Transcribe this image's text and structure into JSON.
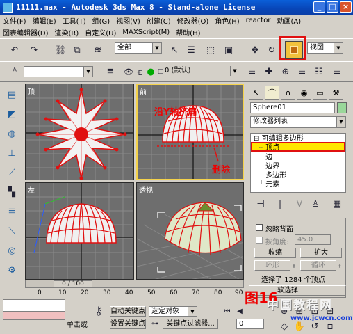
{
  "title": "11111.max - Autodesk 3ds Max 8 - Stand-alone License",
  "menu1": [
    "文件(F)",
    "编辑(E)",
    "工具(T)",
    "组(G)",
    "视图(V)",
    "创建(C)",
    "修改器(O)",
    "角色(H)",
    "reactor",
    "动画(A)"
  ],
  "menu2": [
    "图表编辑器(D)",
    "渲染(R)",
    "自定义(U)",
    "MAXScript(M)",
    "帮助(H)"
  ],
  "toolbar": {
    "selection_filter": "全部",
    "ref_coord": "视图"
  },
  "layer": {
    "current": "0 (默认)"
  },
  "viewports": {
    "top": "顶",
    "front": "前",
    "left": "左",
    "persp": "透视"
  },
  "command_panel": {
    "object_name": "Sphere01",
    "modifier_list": "修改器列表",
    "stack": [
      "可编辑多边形",
      "顶点",
      "边",
      "边界",
      "多边形",
      "元素"
    ],
    "ignore_backfacing": "忽略背面",
    "by_angle": "按角度:",
    "angle_value": "45.0",
    "shrink": "收缩",
    "grow": "扩大",
    "ring": "环形",
    "loop": "循环",
    "selection_info": "选择了 1284 个顶点",
    "soft_selection": "软选择"
  },
  "timeline": {
    "frame": "0 / 100",
    "ticks": [
      "0",
      "10",
      "20",
      "30",
      "40",
      "50",
      "60",
      "70",
      "80",
      "90"
    ]
  },
  "status": {
    "click_or_drag": "单击或",
    "auto_key": "自动关键点",
    "set_key": "设置关键点",
    "selected": "选定对象",
    "key_filters": "关键点过滤器...",
    "frame_field": "0"
  },
  "annotations": {
    "flatten": "沿Y轴挤扁",
    "delete": "删除",
    "figure": "图16"
  },
  "watermark": {
    "line1": "中国教程网",
    "line2": "www.jcwcn.com"
  },
  "colors": {
    "accent_red": "#e01010",
    "highlight_yellow": "#ffe600",
    "vp_active": "#f4d24a"
  }
}
